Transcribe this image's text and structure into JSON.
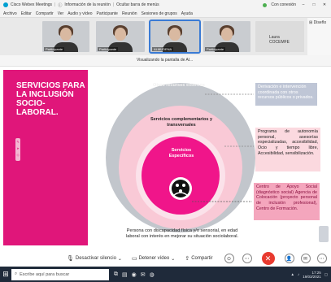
{
  "window": {
    "app_title": "Cisco Webex Meetings",
    "meeting_info": "Información de la reunión",
    "hide_menu": "Ocultar barra de menús",
    "connected": "Con conexión",
    "win_controls": [
      "–",
      "□",
      "✕"
    ]
  },
  "menu": [
    "Archivo",
    "Editar",
    "Compartir",
    "Ver",
    "Audio y vídeo",
    "Participante",
    "Reunión",
    "Sesiones de grupos",
    "Ayuda"
  ],
  "participants": {
    "tiles": [
      {
        "name": "Participante"
      },
      {
        "name": "Participante"
      },
      {
        "name": "ALMUDENA"
      },
      {
        "name": "Participante"
      }
    ],
    "laura_name": "Laura COCEMFE",
    "side_label": "Diseño"
  },
  "share_label": "Visualizando la pantalla de Al...",
  "slide": {
    "title": "SERVICIOS PARA LA INCLUSIÓN SOCIO-LABORAL.",
    "circle_labels": {
      "outer": "Otros recursos externos",
      "middle": "Servicios complementarios y transversales",
      "inner": "Servicios Específicos"
    },
    "box_outer": "Derivación e intervención coordinada con otros recursos públicos o privados.",
    "box_middle": "Programa de autonomía personal, asesorías especializadas, accesibilidad, Ocio y tiempo libre, Accesibilidad, sensibilización.",
    "box_inner": "Centro de Apoyo Social (diagnóstico social) Agencia de Colocación (proyecto personal de inclusión profesional), Centro de Formación.",
    "footer": "Persona con discapacidad física y/o sensorial, en edad laboral con interés en mejorar su situación sociolaboral.",
    "colors": {
      "magenta": "#e0167a",
      "grey_circle": "#c2c6cc",
      "light_pink": "#f9c9d6",
      "hot_pink": "#f0158a"
    }
  },
  "controls": {
    "mute": "Desactivar silencio",
    "video": "Detener vídeo",
    "share": "Compartir",
    "end_icon": "✕"
  },
  "taskbar": {
    "search_placeholder": "Escribe aquí para buscar",
    "time": "17:25",
    "date": "19/03/2021"
  }
}
